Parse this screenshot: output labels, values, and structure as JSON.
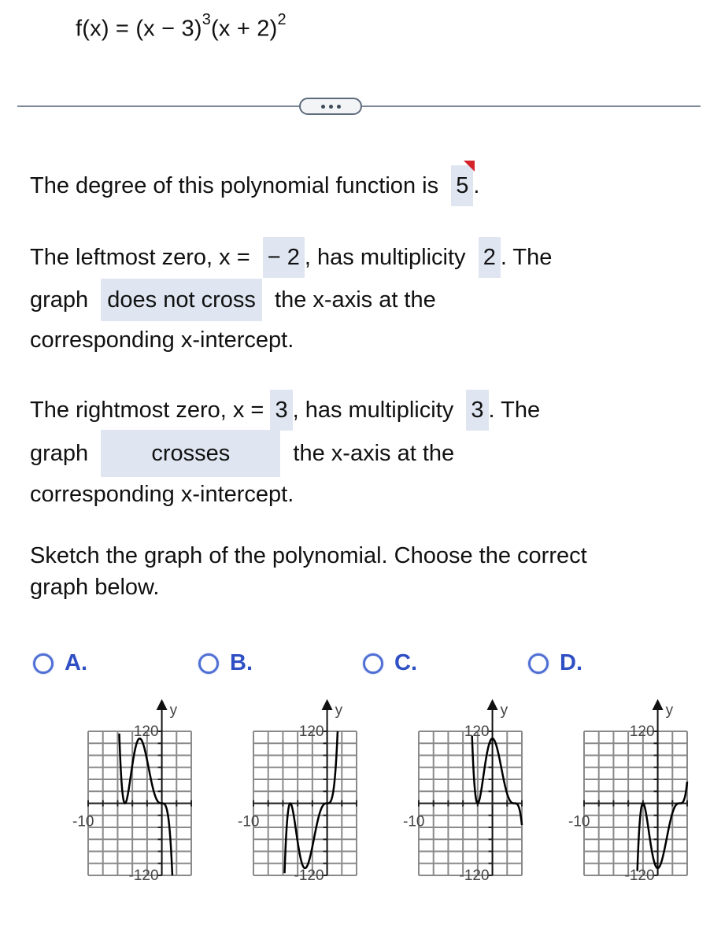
{
  "formula": {
    "prefix": "f(x) = (x − 3)",
    "exp1": "3",
    "middle": "(x + 2)",
    "exp2": "2"
  },
  "more_button": {
    "icon": "ellipsis-icon"
  },
  "degree": {
    "text": "The degree of this polynomial function is",
    "answer": "5",
    "after": "."
  },
  "leftmost": {
    "t1": "The leftmost zero, x =",
    "zero": "− 2",
    "t2": ", has multiplicity",
    "mult": "2",
    "t3": ". The",
    "t4": "graph",
    "behavior": "does not cross",
    "t5": "the x-axis at the",
    "t6": "corresponding x-intercept."
  },
  "rightmost": {
    "t1": "The rightmost zero, x =",
    "zero": "3",
    "t2": ", has multiplicity",
    "mult": "3",
    "t3": ". The",
    "t4": "graph",
    "behavior": "crosses",
    "t5": "the x-axis at the",
    "t6": "corresponding x-intercept."
  },
  "sketch_prompt": {
    "line1": "Sketch the graph of the polynomial. Choose the correct",
    "line2": "graph below."
  },
  "options": [
    {
      "label": "A.",
      "selected": false
    },
    {
      "label": "B.",
      "selected": false
    },
    {
      "label": "C.",
      "selected": false
    },
    {
      "label": "D.",
      "selected": false
    }
  ],
  "chart_data": [
    {
      "type": "line",
      "option": "A",
      "function": "-x^3(x+5)^2",
      "xlim": [
        -10,
        4
      ],
      "ylim": [
        -120,
        120
      ],
      "x_step": 2,
      "y_step": 20,
      "tick_labels": {
        "xmin": "-10",
        "ymax": "120",
        "ymin": "-120"
      },
      "axis_label_y": "y",
      "grid": true
    },
    {
      "type": "line",
      "option": "B",
      "function": "x^3(x+5)^2",
      "xlim": [
        -10,
        4
      ],
      "ylim": [
        -120,
        120
      ],
      "x_step": 2,
      "y_step": 20,
      "tick_labels": {
        "xmin": "-10",
        "ymax": "120",
        "ymin": "-120"
      },
      "axis_label_y": "y",
      "grid": true
    },
    {
      "type": "line",
      "option": "C",
      "function": "-(x-3)^3(x+2)^2",
      "xlim": [
        -10,
        4
      ],
      "ylim": [
        -120,
        120
      ],
      "x_step": 2,
      "y_step": 20,
      "tick_labels": {
        "xmin": "-10",
        "ymax": "120",
        "ymin": "-120"
      },
      "axis_label_y": "y",
      "grid": true
    },
    {
      "type": "line",
      "option": "D",
      "function": "(x-3)^3(x+2)^2",
      "xlim": [
        -10,
        4
      ],
      "ylim": [
        -120,
        120
      ],
      "x_step": 2,
      "y_step": 20,
      "tick_labels": {
        "xmin": "-10",
        "ymax": "120",
        "ymin": "-120"
      },
      "axis_label_y": "y",
      "grid": true
    }
  ]
}
